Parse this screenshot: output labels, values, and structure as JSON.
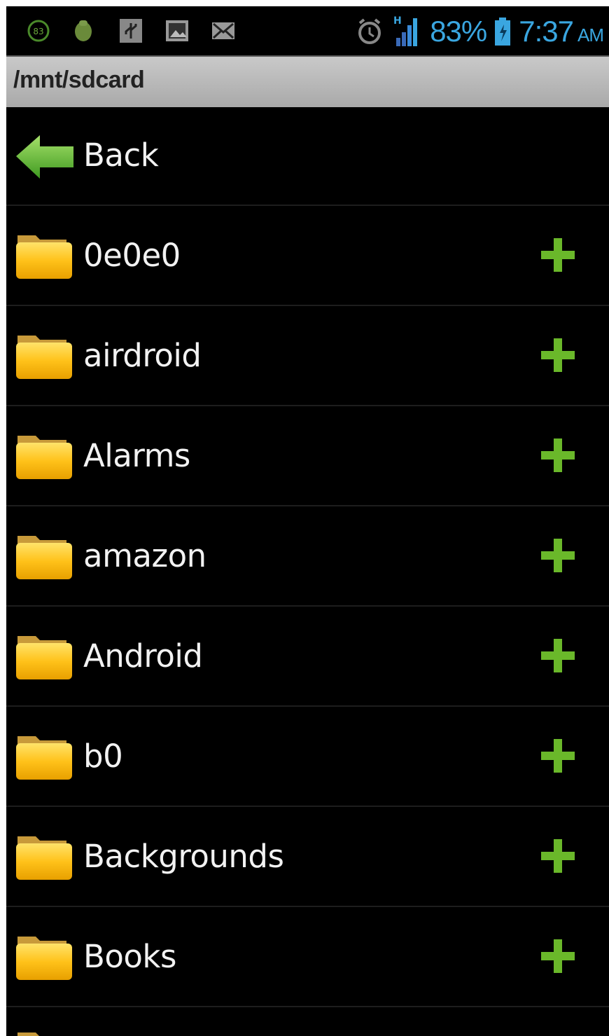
{
  "status_bar": {
    "icons_left": [
      "notification-count-icon",
      "android-icon",
      "usb-icon",
      "picture-icon",
      "mail-icon"
    ],
    "icons_right": [
      "alarm-icon",
      "signal-icon",
      "battery-icon"
    ],
    "battery_percent": "83%",
    "time": "7:37",
    "ampm": "AM",
    "accent_color": "#3aa6e0"
  },
  "header": {
    "path": "/mnt/sdcard"
  },
  "list": {
    "back_label": "Back",
    "folders": [
      {
        "name": "0e0e0"
      },
      {
        "name": "airdroid"
      },
      {
        "name": "Alarms"
      },
      {
        "name": "amazon"
      },
      {
        "name": "Android"
      },
      {
        "name": "b0"
      },
      {
        "name": "Backgrounds"
      },
      {
        "name": "Books"
      }
    ],
    "folder_icon": "folder-icon",
    "add_icon": "plus-icon",
    "colors": {
      "folder": "#f5b800",
      "add": "#6ab82a",
      "back_arrow": "#5cb030"
    }
  }
}
